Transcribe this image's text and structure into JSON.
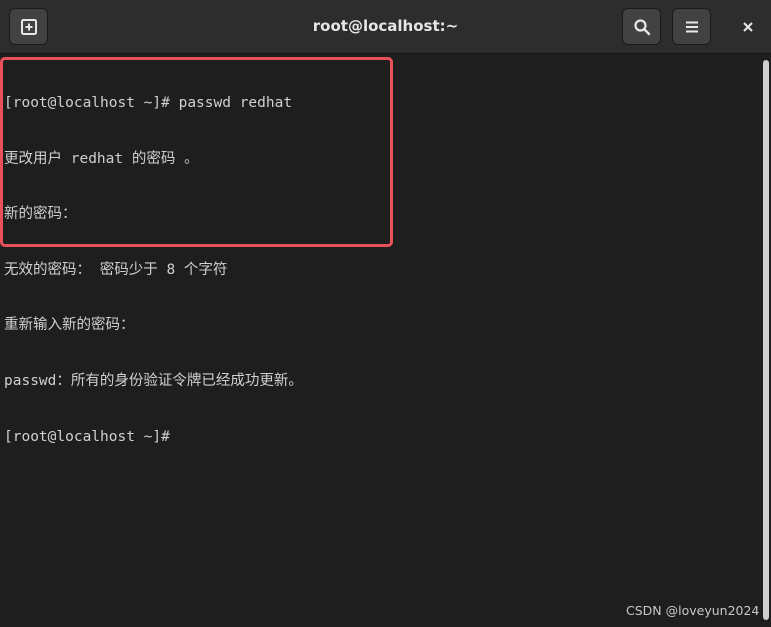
{
  "window": {
    "title": "root@localhost:~"
  },
  "toolbar": {
    "new_tab_icon": "new-tab-icon",
    "search_icon": "search-icon",
    "menu_icon": "hamburger-menu-icon",
    "close_glyph": "×"
  },
  "terminal": {
    "lines": [
      "[root@localhost ~]# passwd redhat",
      "更改用户 redhat 的密码 。",
      "新的密码：",
      "无效的密码： 密码少于 8 个字符",
      "重新输入新的密码：",
      "passwd：所有的身份验证令牌已经成功更新。",
      "[root@localhost ~]#"
    ]
  },
  "watermark": "CSDN @loveyun2024",
  "colors": {
    "background": "#1e1e1e",
    "titlebar": "#2d2d2d",
    "text": "#d0d0d0",
    "highlight": "#e8505b"
  }
}
